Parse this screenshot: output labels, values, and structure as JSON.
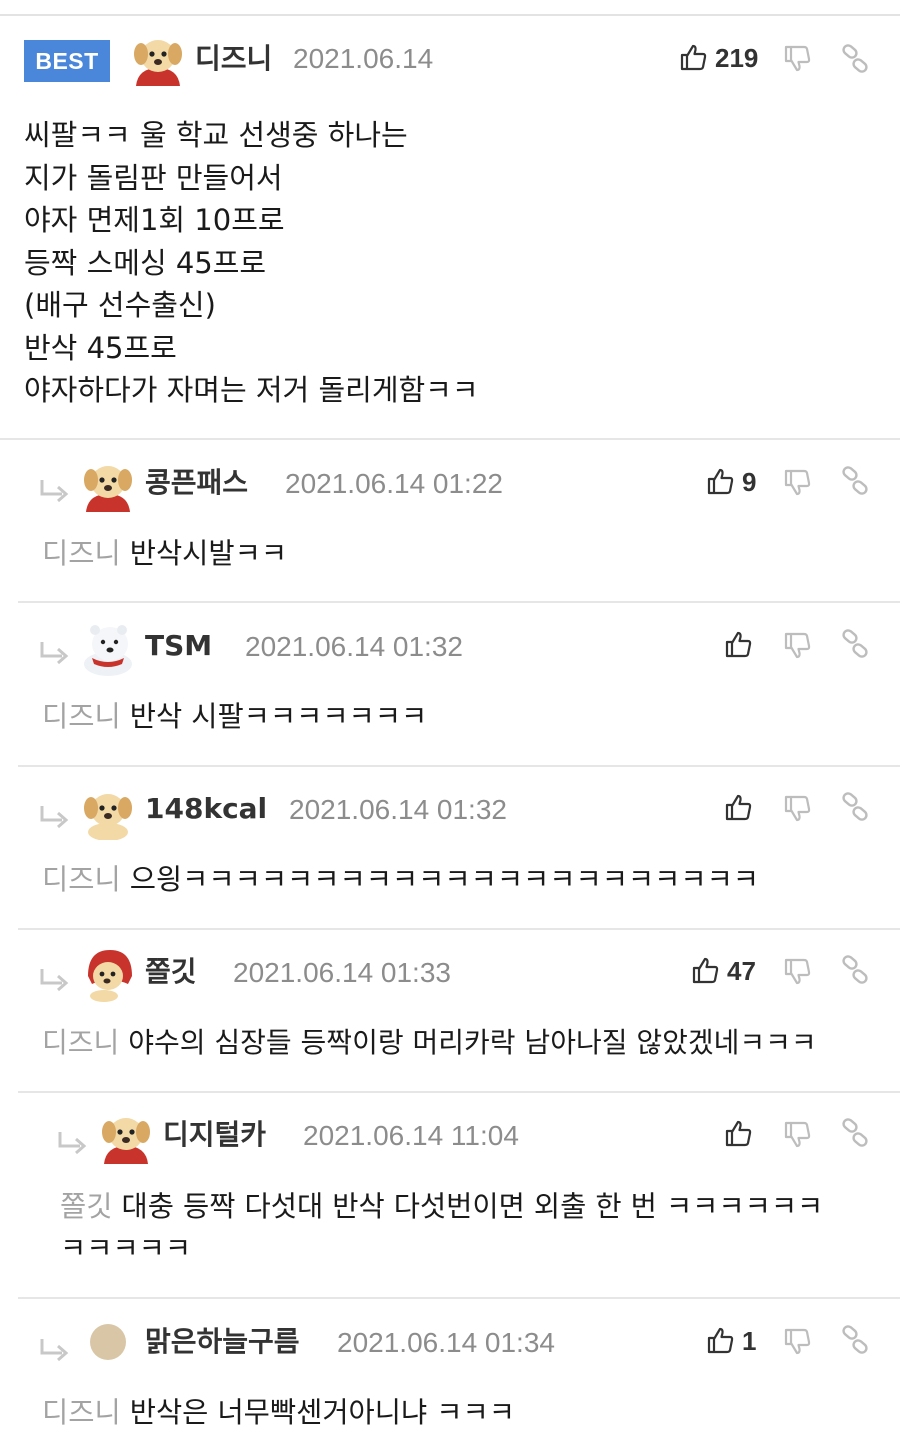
{
  "best": {
    "badge": "BEST",
    "author": "디즈니",
    "date": "2021.06.14",
    "likes": "219",
    "lines": [
      "씨팔ㅋㅋ 울 학교 선생중 하나는",
      "지가 돌림판 만들어서",
      "야자 면제1회 10프로",
      "등짝 스메싱 45프로",
      "(배구 선수출신)",
      "반삭 45프로",
      "야자하다가 자며는 저거 돌리게함ㅋㅋ"
    ]
  },
  "replies": [
    {
      "author": "콩픈패스",
      "date": "2021.06.14 01:22",
      "likes": "9",
      "mention": "디즈니",
      "text": "반삭시발ㅋㅋ",
      "avatar": "puppy-red-cape"
    },
    {
      "author": "TSM",
      "date": "2021.06.14 01:32",
      "likes": "",
      "mention": "디즈니",
      "text": "반삭 시팔ㅋㅋㅋㅋㅋㅋㅋ",
      "avatar": "polar-bear"
    },
    {
      "author": "148kcal",
      "date": "2021.06.14 01:32",
      "likes": "",
      "mention": "디즈니",
      "text": "으읭ㅋㅋㅋㅋㅋㅋㅋㅋㅋㅋㅋㅋㅋㅋㅋㅋㅋㅋㅋㅋㅋㅋ",
      "avatar": "puppy"
    },
    {
      "author": "쫄깃",
      "date": "2021.06.14 01:33",
      "likes": "47",
      "mention": "디즈니",
      "text": "야수의 심장들 등짝이랑 머리카락 남아나질 않았겠네ㅋㅋㅋ",
      "avatar": "puppy-red-hood"
    },
    {
      "author": "디지털카",
      "date": "2021.06.14 11:04",
      "likes": "",
      "mention": "쫄깃",
      "text": "대충 등짝 다섯대 반삭 다섯번이면 외출 한 번 ㅋㅋㅋㅋㅋㅋ",
      "text2": "ㅋㅋㅋㅋㅋ",
      "avatar": "puppy-red-cape"
    },
    {
      "author": "맑은하늘구름",
      "date": "2021.06.14 01:34",
      "likes": "1",
      "mention": "디즈니",
      "text": "반삭은 너무빡센거아니냐 ㅋㅋㅋ",
      "avatar": "beige-circle"
    }
  ],
  "colors": {
    "accent": "#4a86d9",
    "muted": "#8c8c8c",
    "mention": "#a3a3a3"
  }
}
